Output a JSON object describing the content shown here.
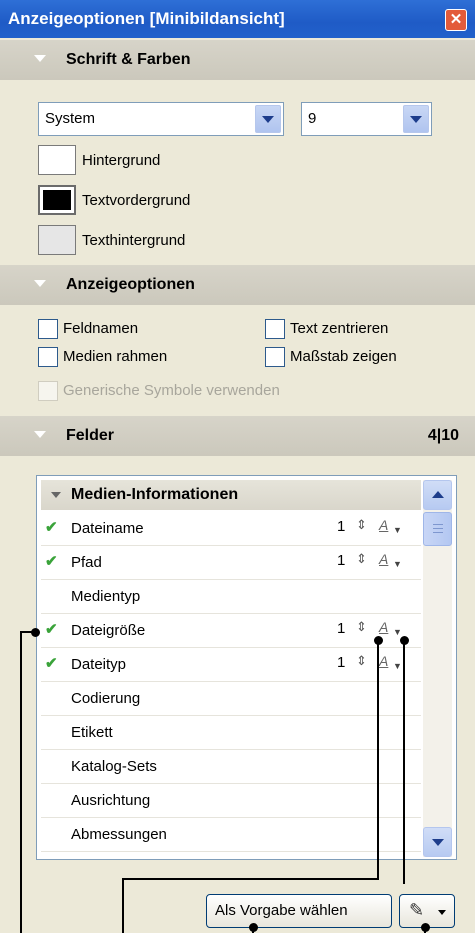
{
  "window": {
    "title": "Anzeigeoptionen [Minibildansicht]",
    "close_glyph": "✕"
  },
  "font_section": {
    "header": "Schrift & Farben",
    "font_name": "System",
    "font_size": "9",
    "colors": [
      {
        "label": "Hintergrund",
        "swatch": "#ffffff"
      },
      {
        "label": "Textvordergrund",
        "swatch": "#000000"
      },
      {
        "label": "Texthintergrund",
        "swatch": "#e6e6e6"
      }
    ]
  },
  "display_section": {
    "header": "Anzeigeoptionen",
    "options": [
      {
        "label": "Feldnamen",
        "checked": false,
        "enabled": true
      },
      {
        "label": "Text zentrieren",
        "checked": false,
        "enabled": true
      },
      {
        "label": "Medien rahmen",
        "checked": false,
        "enabled": true
      },
      {
        "label": "Maßstab zeigen",
        "checked": false,
        "enabled": true
      },
      {
        "label": "Generische Symbole verwenden",
        "checked": false,
        "enabled": false
      }
    ]
  },
  "fields_section": {
    "header": "Felder",
    "count": "4|10",
    "group": "Medien-Informationen",
    "rows": [
      {
        "name": "Dateiname",
        "checked": true,
        "lines": "1"
      },
      {
        "name": "Pfad",
        "checked": true,
        "lines": "1"
      },
      {
        "name": "Medientyp",
        "checked": false,
        "lines": ""
      },
      {
        "name": "Dateigröße",
        "checked": true,
        "lines": "1"
      },
      {
        "name": "Dateityp",
        "checked": true,
        "lines": "1"
      },
      {
        "name": "Codierung",
        "checked": false,
        "lines": ""
      },
      {
        "name": "Etikett",
        "checked": false,
        "lines": ""
      },
      {
        "name": "Katalog-Sets",
        "checked": false,
        "lines": ""
      },
      {
        "name": "Ausrichtung",
        "checked": false,
        "lines": ""
      },
      {
        "name": "Abmessungen",
        "checked": false,
        "lines": ""
      }
    ],
    "check_glyph": "✔",
    "spin_glyph": "⇕",
    "format_glyph": "A"
  },
  "footer": {
    "default_button": "Als Vorgabe wählen",
    "menu_icon": "pencil-icon"
  },
  "colors": {
    "titlebar": "#2161cb",
    "section_header": "#cbc8bc",
    "panel": "#ece9d8",
    "check": "#3aa33a"
  }
}
